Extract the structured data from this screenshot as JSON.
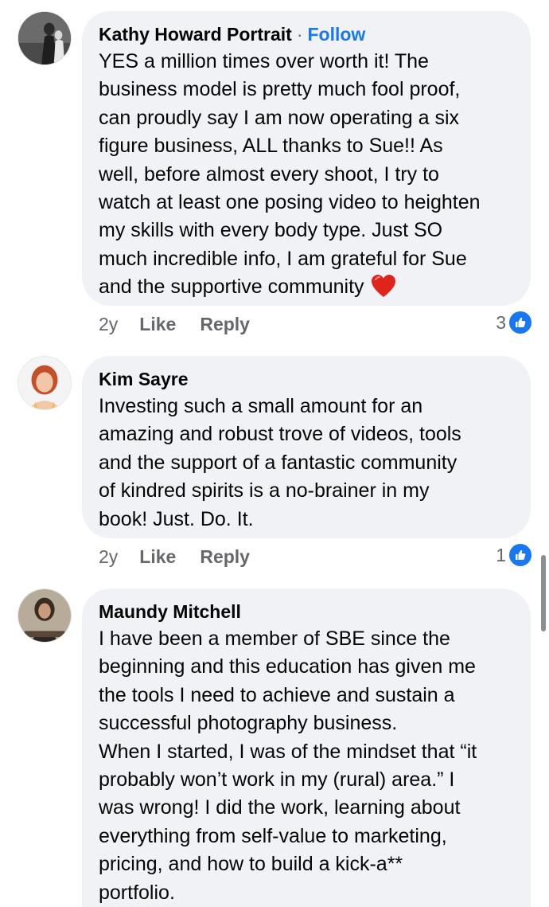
{
  "comments": [
    {
      "author": "Kathy Howard Portrait",
      "follow_label": "Follow",
      "separator": "·",
      "text": "YES a million times over worth it!  The\nbusiness model is pretty much fool proof,\ncan proudly say I am now operating a six\nfigure business, ALL thanks to Sue!!  As\nwell, before almost every shoot, I try to\nwatch at least one posing video to heighten\nmy skills with every body type.  Just SO\nmuch incredible info, I am grateful for Sue\nand the supportive community",
      "emoji": "heart-emoji",
      "time": "2y",
      "like_label": "Like",
      "reply_label": "Reply",
      "reaction_count": "3"
    },
    {
      "author": "Kim Sayre",
      "text": "Investing such a small amount for an\namazing and robust trove of videos, tools\nand the support of a fantastic community\nof kindred spirits is a no-brainer in my\nbook! Just. Do. It.",
      "time": "2y",
      "like_label": "Like",
      "reply_label": "Reply",
      "reaction_count": "1"
    },
    {
      "author": "Maundy Mitchell",
      "text": "I have been a member of SBE since the\nbeginning and this education has given me\nthe tools I need to achieve and sustain a\nsuccessful photography business.\nWhen I started, I was of the mindset that “it\nprobably won’t work in my (rural) area.”  I\nwas wrong!  I did the work, learning about\neverything from self-value to marketing,\npricing, and how to build a kick-a**\nportfolio."
    }
  ],
  "colors": {
    "bubble": "#f0f2f5",
    "link": "#1877f2",
    "meta": "#65676b",
    "text": "#050505"
  }
}
